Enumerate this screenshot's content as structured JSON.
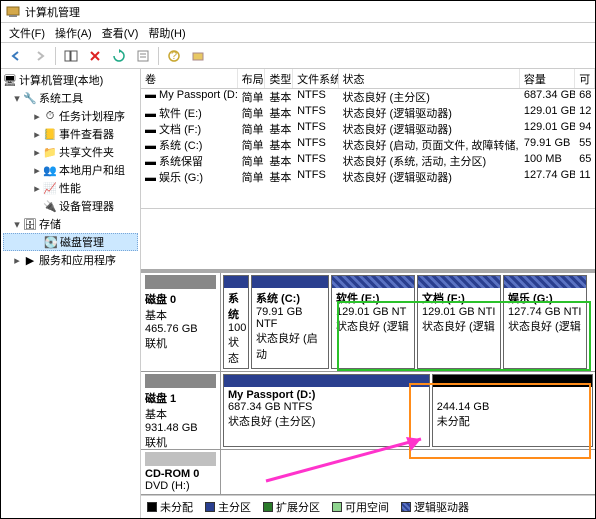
{
  "title": "计算机管理",
  "menu": {
    "file": "文件(F)",
    "action": "操作(A)",
    "view": "查看(V)",
    "help": "帮助(H)"
  },
  "tree": {
    "root": "计算机管理(本地)",
    "systools": "系统工具",
    "tasksched": "任务计划程序",
    "eventvwr": "事件查看器",
    "shared": "共享文件夹",
    "users": "本地用户和组",
    "perf": "性能",
    "devmgr": "设备管理器",
    "storage": "存储",
    "diskmgmt": "磁盘管理",
    "services": "服务和应用程序"
  },
  "columns": {
    "volume": "卷",
    "layout": "布局",
    "type": "类型",
    "fs": "文件系统",
    "status": "状态",
    "capacity": "容量",
    "free": "可"
  },
  "rows": [
    {
      "v": "My Passport (D:)",
      "l": "简单",
      "t": "基本",
      "f": "NTFS",
      "s": "状态良好 (主分区)",
      "c": "687.34 GB",
      "fr": "68"
    },
    {
      "v": "软件 (E:)",
      "l": "简单",
      "t": "基本",
      "f": "NTFS",
      "s": "状态良好 (逻辑驱动器)",
      "c": "129.01 GB",
      "fr": "12"
    },
    {
      "v": "文档 (F:)",
      "l": "简单",
      "t": "基本",
      "f": "NTFS",
      "s": "状态良好 (逻辑驱动器)",
      "c": "129.01 GB",
      "fr": "94"
    },
    {
      "v": "系统 (C:)",
      "l": "简单",
      "t": "基本",
      "f": "NTFS",
      "s": "状态良好 (启动, 页面文件, 故障转储, 主分区)",
      "c": "79.91 GB",
      "fr": "55"
    },
    {
      "v": "系统保留",
      "l": "简单",
      "t": "基本",
      "f": "NTFS",
      "s": "状态良好 (系统, 活动, 主分区)",
      "c": "100 MB",
      "fr": "65"
    },
    {
      "v": "娱乐 (G:)",
      "l": "简单",
      "t": "基本",
      "f": "NTFS",
      "s": "状态良好 (逻辑驱动器)",
      "c": "127.74 GB",
      "fr": "11"
    }
  ],
  "disk0": {
    "name": "磁盘 0",
    "type": "基本",
    "size": "465.76 GB",
    "status": "联机",
    "vols": [
      {
        "n1": "系统",
        "n2": "100",
        "n3": "状态"
      },
      {
        "n1": "系统  (C:)",
        "n2": "79.91 GB NTF",
        "n3": "状态良好 (启动"
      },
      {
        "n1": "软件  (E:)",
        "n2": "129.01 GB NT",
        "n3": "状态良好 (逻辑"
      },
      {
        "n1": "文档  (F:)",
        "n2": "129.01 GB NTI",
        "n3": "状态良好 (逻辑"
      },
      {
        "n1": "娱乐  (G:)",
        "n2": "127.74 GB NTI",
        "n3": "状态良好 (逻辑"
      }
    ]
  },
  "disk1": {
    "name": "磁盘 1",
    "type": "基本",
    "size": "931.48 GB",
    "status": "联机",
    "v1": {
      "n1": "My Passport  (D:)",
      "n2": "687.34 GB NTFS",
      "n3": "状态良好 (主分区)"
    },
    "v2": {
      "n1": "244.14 GB",
      "n2": "未分配"
    }
  },
  "cdrom": {
    "name": "CD-ROM 0",
    "dev": "DVD (H:)"
  },
  "legend": {
    "unalloc": "未分配",
    "primary": "主分区",
    "ext": "扩展分区",
    "free": "可用空间",
    "logical": "逻辑驱动器"
  }
}
